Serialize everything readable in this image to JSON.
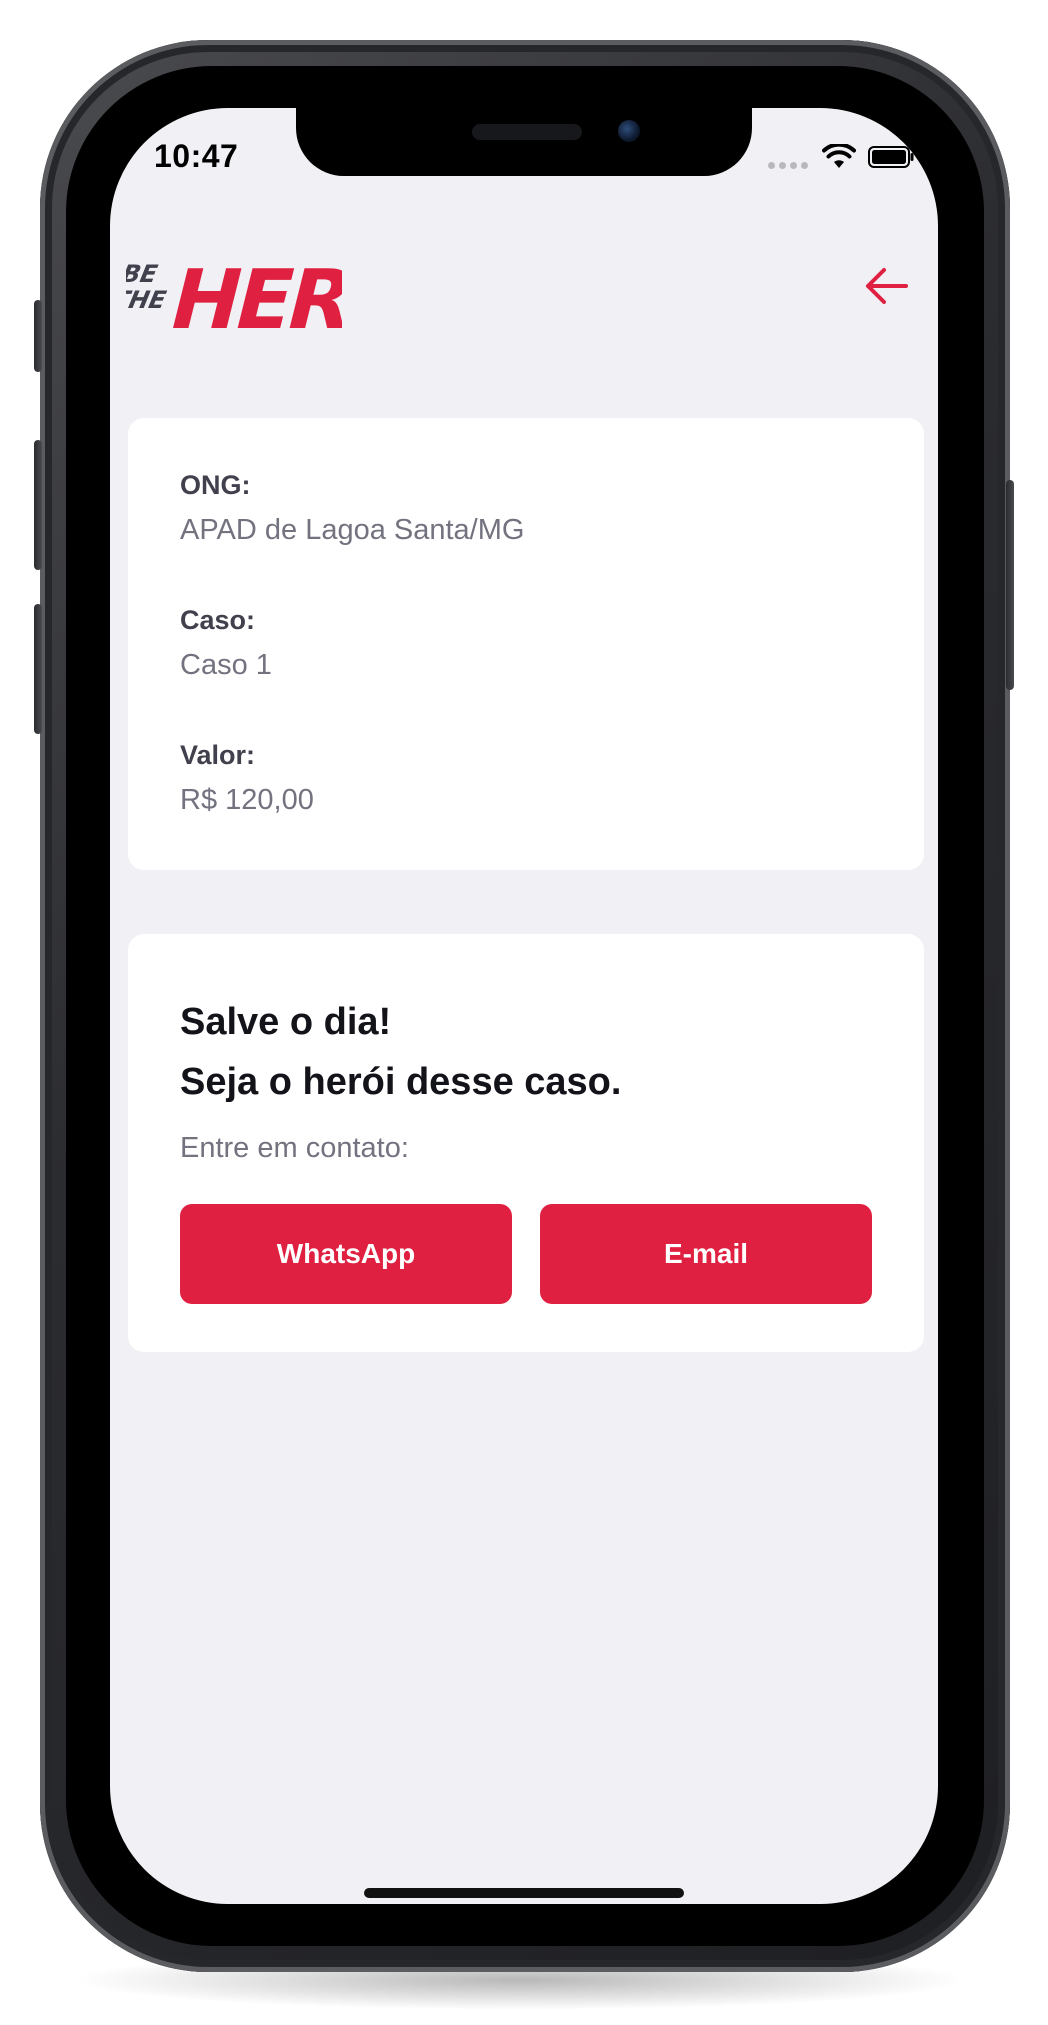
{
  "status_bar": {
    "time": "10:47"
  },
  "header": {
    "logo_alt": "BE THE HERO"
  },
  "case": {
    "ong_label": "ONG:",
    "ong_value": "APAD de Lagoa Santa/MG",
    "case_label": "Caso:",
    "case_value": "Caso 1",
    "value_label": "Valor:",
    "value_value": "R$ 120,00"
  },
  "contact": {
    "title_line1": "Salve o dia!",
    "title_line2": "Seja o herói desse caso.",
    "description": "Entre em contato:",
    "whatsapp_label": "WhatsApp",
    "email_label": "E-mail"
  },
  "colors": {
    "accent": "#e02041",
    "background": "#f0f0f5",
    "label": "#41414d",
    "value": "#737380"
  }
}
